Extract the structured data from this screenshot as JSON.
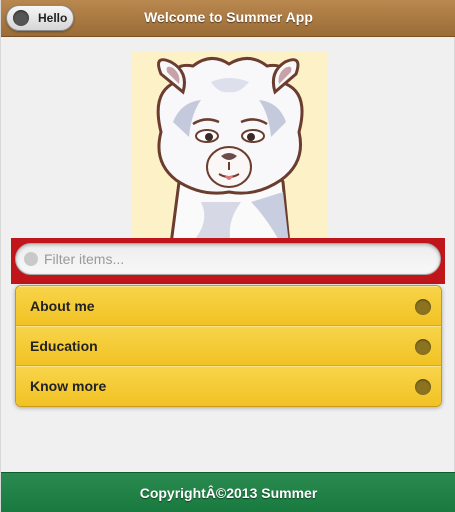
{
  "header": {
    "title": "Welcome to Summer App",
    "hello_button": "Hello"
  },
  "picture": {
    "description_icon": "alpaca-illustration"
  },
  "filter": {
    "placeholder": "Filter items..."
  },
  "list": {
    "items": [
      {
        "label": "About me"
      },
      {
        "label": "Education"
      },
      {
        "label": "Know more"
      }
    ]
  },
  "footer": {
    "text": "CopyrightÂ©2013 Summer"
  },
  "colors": {
    "header": "#a87a44",
    "filter_bar": "#c0151a",
    "list_item": "#f4c92f",
    "footer": "#1f8046"
  }
}
